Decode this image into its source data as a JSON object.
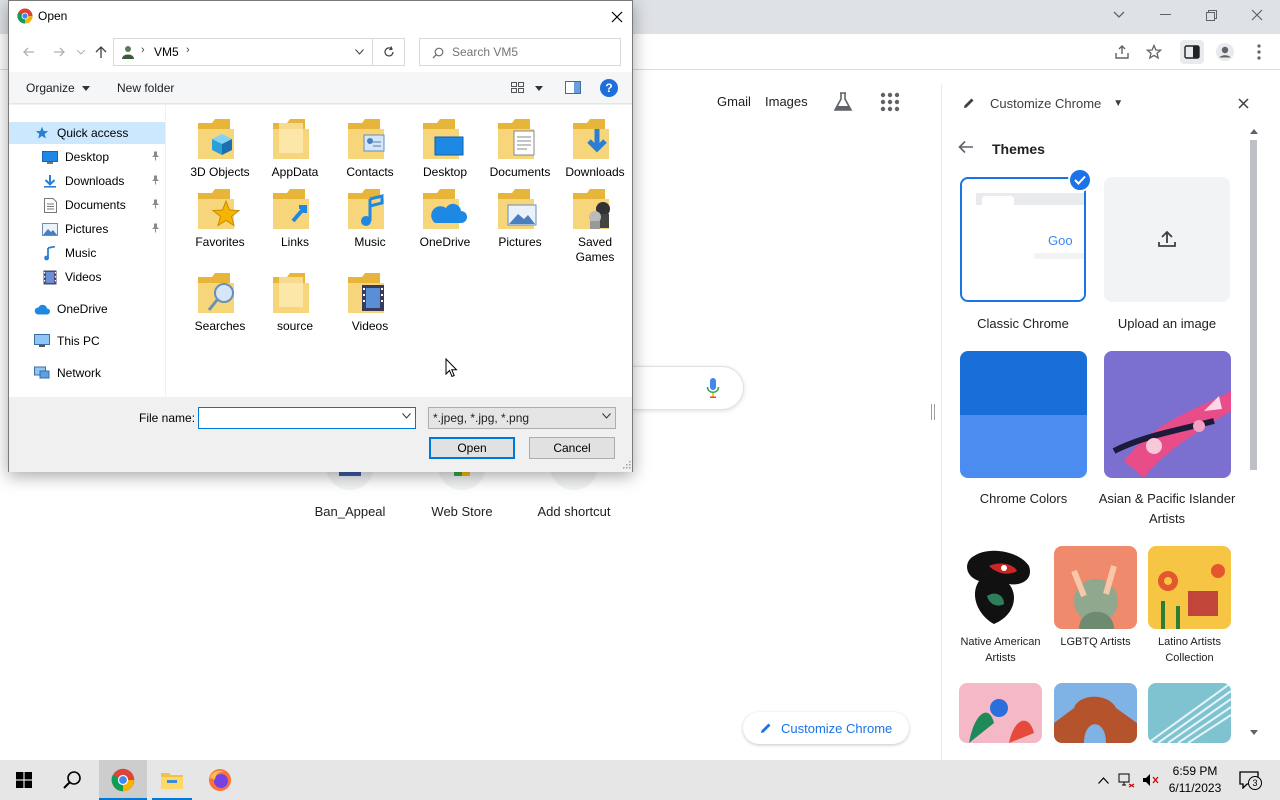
{
  "browser": {
    "window_controls": [
      "chevron-down",
      "minimize",
      "restore",
      "close"
    ],
    "links": {
      "gmail": "Gmail",
      "images": "Images"
    },
    "shortcuts": [
      "Ban_Appeal",
      "Web Store",
      "Add shortcut"
    ],
    "customize_button": "Customize Chrome"
  },
  "side_panel": {
    "header_title": "Customize Chrome",
    "section_title": "Themes",
    "themes": [
      {
        "label": "Classic Chrome",
        "selected": true,
        "preview_text": "Goo"
      },
      {
        "label": "Upload an image"
      },
      {
        "label": "Chrome Colors"
      },
      {
        "label": "Asian & Pacific Islander Artists"
      },
      {
        "label": "Native American Artists"
      },
      {
        "label": "LGBTQ Artists"
      },
      {
        "label": "Latino Artists Collection"
      }
    ]
  },
  "dialog": {
    "title": "Open",
    "address": {
      "path": "VM5"
    },
    "search_placeholder": "Search VM5",
    "commands": {
      "organize": "Organize",
      "new_folder": "New folder"
    },
    "nav_pane": [
      {
        "label": "Quick access",
        "icon": "star-icon",
        "selected": true
      },
      {
        "label": "Desktop",
        "icon": "desktop-icon",
        "pinned": true
      },
      {
        "label": "Downloads",
        "icon": "download-icon",
        "pinned": true
      },
      {
        "label": "Documents",
        "icon": "documents-icon",
        "pinned": true
      },
      {
        "label": "Pictures",
        "icon": "pictures-icon",
        "pinned": true
      },
      {
        "label": "Music",
        "icon": "music-icon"
      },
      {
        "label": "Videos",
        "icon": "videos-icon"
      },
      {
        "label": "OneDrive",
        "icon": "cloud-icon"
      },
      {
        "label": "This PC",
        "icon": "computer-icon"
      },
      {
        "label": "Network",
        "icon": "network-icon"
      }
    ],
    "files": [
      "3D Objects",
      "AppData",
      "Contacts",
      "Desktop",
      "Documents",
      "Downloads",
      "Favorites",
      "Links",
      "Music",
      "OneDrive",
      "Pictures",
      "Saved Games",
      "Searches",
      "source",
      "Videos"
    ],
    "file_name_label": "File name:",
    "file_name_value": "",
    "file_type": "*.jpeg, *.jpg, *.png",
    "open_button": "Open",
    "cancel_button": "Cancel"
  },
  "taskbar": {
    "time": "6:59 PM",
    "date": "6/11/2023",
    "notification_count": "3"
  }
}
